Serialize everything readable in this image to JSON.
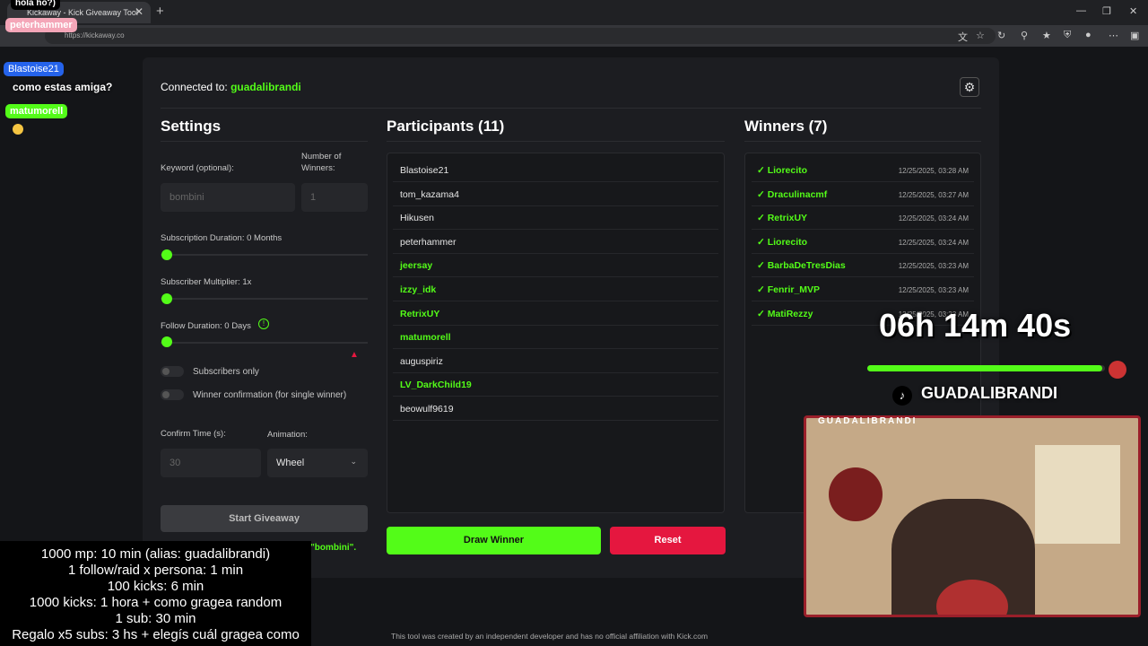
{
  "browser": {
    "tab_title": "Kickaway - Kick Giveaway Tool",
    "url": "https://kickaway.co"
  },
  "header": {
    "connected_label": "Connected to:",
    "connected_user": "guadalibrandi"
  },
  "settings": {
    "title": "Settings",
    "keyword_label": "Keyword (optional):",
    "keyword_placeholder": "bombini",
    "winners_label_1": "Number of",
    "winners_label_2": "Winners:",
    "winners_value": "1",
    "sub_duration_label": "Subscription Duration: 0 Months",
    "sub_multiplier_label": "Subscriber Multiplier: 1x",
    "follow_duration_label": "Follow Duration: 0 Days",
    "subscribers_only_label": "Subscribers only",
    "winner_confirmation_label": "Winner confirmation (for single winner)",
    "confirm_time_label": "Confirm Time (s):",
    "confirm_time_value": "30",
    "animation_label": "Animation:",
    "animation_value": "Wheel",
    "start_button": "Start Giveaway",
    "keyword_note": "\"bombini\"."
  },
  "participants": {
    "title": "Participants (11)",
    "items": [
      {
        "name": "Blastoise21",
        "sub": false
      },
      {
        "name": "tom_kazama4",
        "sub": false
      },
      {
        "name": "Hikusen",
        "sub": false
      },
      {
        "name": "peterhammer",
        "sub": false
      },
      {
        "name": "jeersay",
        "sub": true
      },
      {
        "name": "izzy_idk",
        "sub": true
      },
      {
        "name": "RetrixUY",
        "sub": true
      },
      {
        "name": "matumorell",
        "sub": true
      },
      {
        "name": "auguspiriz",
        "sub": false
      },
      {
        "name": "LV_DarkChild19",
        "sub": true
      },
      {
        "name": "beowulf9619",
        "sub": false
      }
    ],
    "draw_button": "Draw Winner",
    "reset_button": "Reset"
  },
  "winners": {
    "title": "Winners (7)",
    "items": [
      {
        "name": "✓ Liorecito",
        "time": "12/25/2025, 03:28 AM"
      },
      {
        "name": "✓ Draculinacmf",
        "time": "12/25/2025, 03:27 AM"
      },
      {
        "name": "✓ RetrixUY",
        "time": "12/25/2025, 03:24 AM"
      },
      {
        "name": "✓ Liorecito",
        "time": "12/25/2025, 03:24 AM"
      },
      {
        "name": "✓ BarbaDeTresDias",
        "time": "12/25/2025, 03:23 AM"
      },
      {
        "name": "✓ Fenrir_MVP",
        "time": "12/25/2025, 03:23 AM"
      },
      {
        "name": "✓ MatiRezzy",
        "time": "12/25/2025, 03:23 AM"
      }
    ]
  },
  "footer": "This tool was created by an independent developer and has no official affiliation with Kick.com",
  "overlay": {
    "chat": {
      "line0": "hola ho?)",
      "user1": "peterhammer",
      "user2": "Blastoise21",
      "msg2": "como estas amiga?",
      "user3": "matumorell"
    },
    "rules": [
      "1000 mp: 10 min (alias: guadalibrandi)",
      "1 follow/raid x persona: 1 min",
      "100 kicks: 6 min",
      "1000 kicks: 1 hora + como gragea random",
      "1 sub: 30 min",
      "Regalo x5 subs: 3 hs + elegís cuál gragea como"
    ],
    "timer": "06h 14m 40s",
    "timer_progress": 0.99,
    "tiktok_handle": "GUADALIBRANDI",
    "cam_label": "GUADALIBRANDI"
  },
  "colors": {
    "accent": "#53fc18",
    "reset": "#e5173f",
    "background": "#141518"
  }
}
